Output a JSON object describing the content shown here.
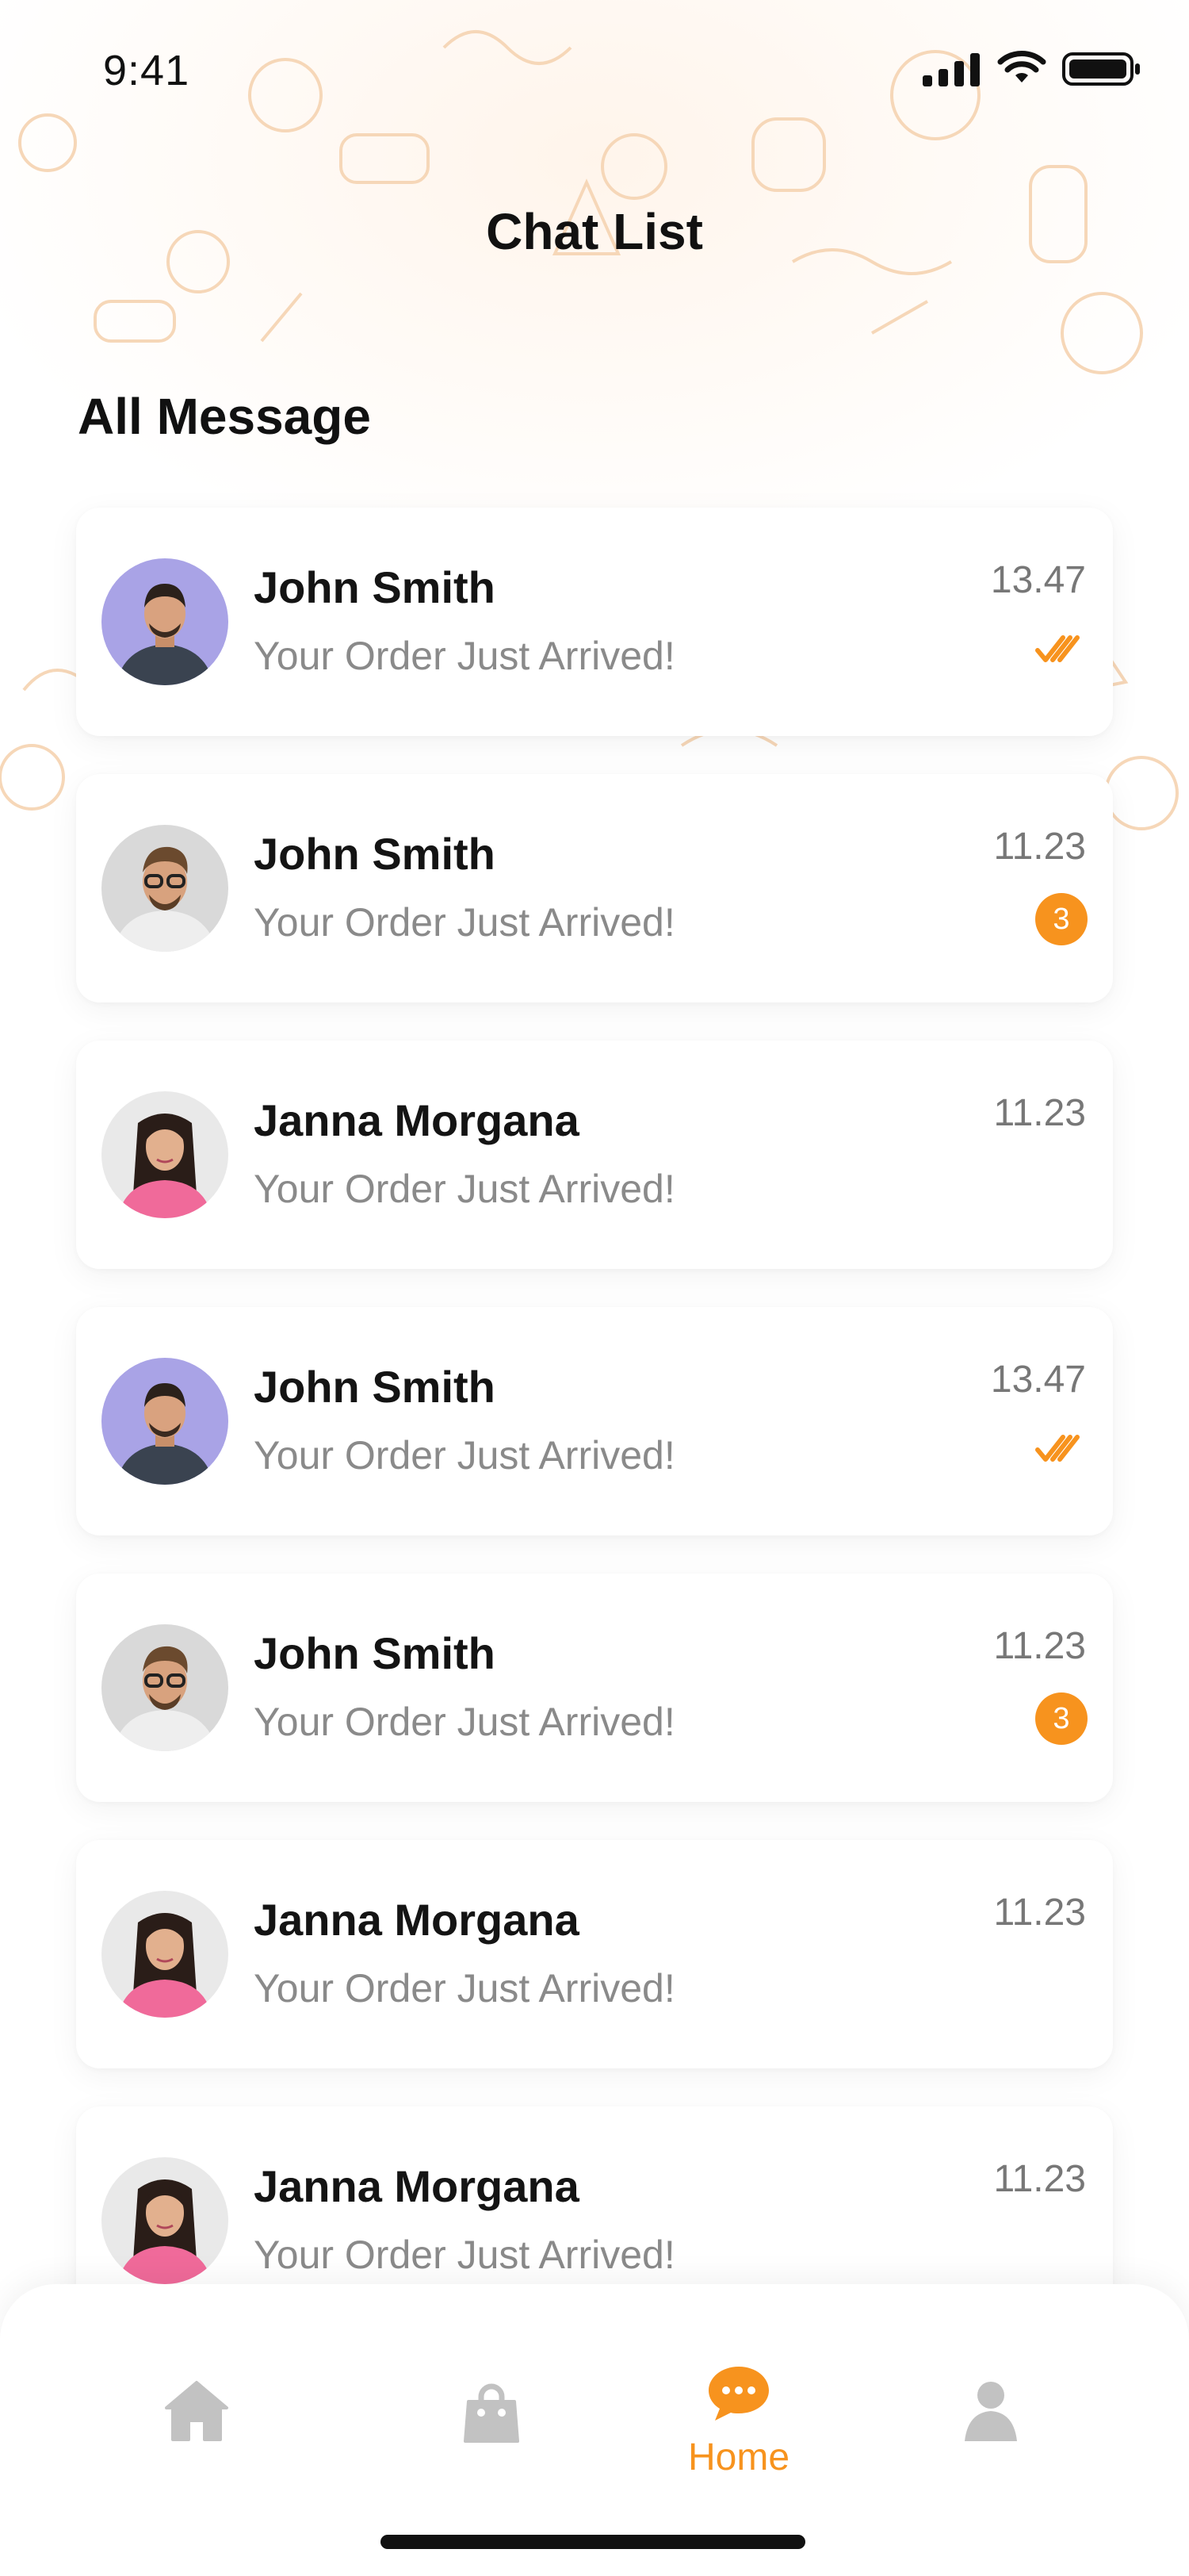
{
  "status_bar": {
    "time": "9:41"
  },
  "header": {
    "title": "Chat List"
  },
  "section": {
    "title": "All Message"
  },
  "colors": {
    "accent": "#f7931e",
    "muted_text": "#8a8a8a",
    "nav_icon": "#c2c2c2"
  },
  "chats": [
    {
      "name": "John Smith",
      "message": "Your Order Just Arrived!",
      "time": "13.47",
      "status": "read",
      "badge": "",
      "avatar": "man-purple"
    },
    {
      "name": "John Smith",
      "message": "Your Order Just Arrived!",
      "time": "11.23",
      "status": "unread",
      "badge": "3",
      "avatar": "man-glasses"
    },
    {
      "name": "Janna Morgana",
      "message": "Your Order Just Arrived!",
      "time": "11.23",
      "status": "none",
      "badge": "",
      "avatar": "woman-pink"
    },
    {
      "name": "John Smith",
      "message": "Your Order Just Arrived!",
      "time": "13.47",
      "status": "read",
      "badge": "",
      "avatar": "man-purple"
    },
    {
      "name": "John Smith",
      "message": "Your Order Just Arrived!",
      "time": "11.23",
      "status": "unread",
      "badge": "3",
      "avatar": "man-glasses"
    },
    {
      "name": "Janna Morgana",
      "message": "Your Order Just Arrived!",
      "time": "11.23",
      "status": "none",
      "badge": "",
      "avatar": "woman-pink"
    },
    {
      "name": "Janna Morgana",
      "message": "Your Order Just Arrived!",
      "time": "11.23",
      "status": "none",
      "badge": "",
      "avatar": "woman-pink"
    }
  ],
  "bottom_nav": {
    "items": [
      {
        "icon": "home-icon",
        "label": ""
      },
      {
        "icon": "shopping-bag-icon",
        "label": ""
      },
      {
        "icon": "chat-bubble-icon",
        "label": "Home",
        "active": true
      },
      {
        "icon": "profile-icon",
        "label": ""
      }
    ]
  }
}
